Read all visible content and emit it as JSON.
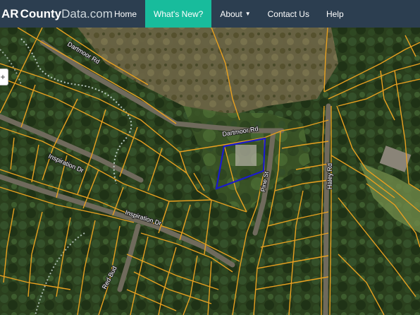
{
  "brand": {
    "prefix": "AR",
    "name": "County",
    "suffix": "Data.com",
    "icon": "arkansas-state-icon"
  },
  "nav": {
    "home": "Home",
    "whats_new": "What's New?",
    "about": "About",
    "contact": "Contact Us",
    "help": "Help"
  },
  "map": {
    "zoom_control": "+",
    "roads": {
      "dartmoor_top": "Dartmoor Rd",
      "dartmoor_mid": "Dartmoor Rd",
      "inspiration_left": "Inspiration Dr",
      "inspiration_mid": "Inspiration Dr",
      "pine": "Pine St",
      "haley": "Haley Rd",
      "red_bud": "Red Bud"
    },
    "colors": {
      "parcel_line": "#e8a020",
      "selected_parcel": "#1a1acc",
      "trail": "#c8d6d0"
    }
  }
}
